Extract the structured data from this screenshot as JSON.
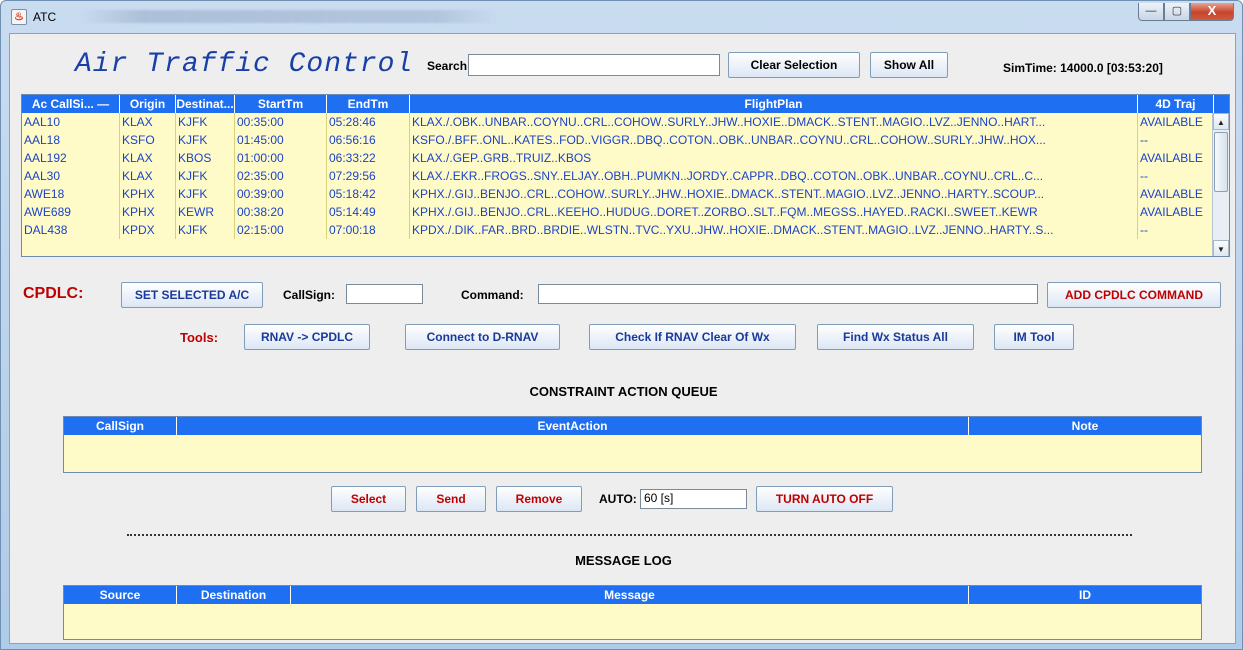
{
  "window": {
    "title": "ATC",
    "controls": {
      "minimize": "—",
      "maximize": "▢",
      "close": "X"
    }
  },
  "header": {
    "app_title": "Air Traffic Control",
    "search_label": "Search",
    "search_value": "",
    "clear_selection": "Clear Selection",
    "show_all": "Show All",
    "simtime": "SimTime: 14000.0 [03:53:20]"
  },
  "flights": {
    "columns": [
      "Ac CallSi... —",
      "Origin",
      "Destinat...",
      "StartTm",
      "EndTm",
      "FlightPlan",
      "4D Traj"
    ],
    "rows": [
      [
        "AAL10",
        "KLAX",
        "KJFK",
        "00:35:00",
        "05:28:46",
        "KLAX./.OBK..UNBAR..COYNU..CRL..COHOW..SURLY..JHW..HOXIE..DMACK..STENT..MAGIO..LVZ..JENNO..HART...",
        "AVAILABLE"
      ],
      [
        "AAL18",
        "KSFO",
        "KJFK",
        "01:45:00",
        "06:56:16",
        "KSFO./.BFF..ONL..KATES..FOD..VIGGR..DBQ..COTON..OBK..UNBAR..COYNU..CRL..COHOW..SURLY..JHW..HOX...",
        "--"
      ],
      [
        "AAL192",
        "KLAX",
        "KBOS",
        "01:00:00",
        "06:33:22",
        "KLAX./.GEP..GRB..TRUIZ..KBOS",
        "AVAILABLE"
      ],
      [
        "AAL30",
        "KLAX",
        "KJFK",
        "02:35:00",
        "07:29:56",
        "KLAX./.EKR..FROGS..SNY..ELJAY..OBH..PUMKN..JORDY..CAPPR..DBQ..COTON..OBK..UNBAR..COYNU..CRL..C...",
        "--"
      ],
      [
        "AWE18",
        "KPHX",
        "KJFK",
        "00:39:00",
        "05:18:42",
        "KPHX./.GIJ..BENJO..CRL..COHOW..SURLY..JHW..HOXIE..DMACK..STENT..MAGIO..LVZ..JENNO..HARTY..SCOUP...",
        "AVAILABLE"
      ],
      [
        "AWE689",
        "KPHX",
        "KEWR",
        "00:38:20",
        "05:14:49",
        "KPHX./.GIJ..BENJO..CRL..KEEHO..HUDUG..DORET..ZORBO..SLT..FQM..MEGSS..HAYED..RACKI..SWEET..KEWR",
        "AVAILABLE"
      ],
      [
        "DAL438",
        "KPDX",
        "KJFK",
        "02:15:00",
        "07:00:18",
        "KPDX./.DIK..FAR..BRD..BRDIE..WLSTN..TVC..YXU..JHW..HOXIE..DMACK..STENT..MAGIO..LVZ..JENNO..HARTY..S...",
        "--"
      ]
    ]
  },
  "cpdlc": {
    "label": "CPDLC:",
    "set_selected": "SET SELECTED A/C",
    "callsign_label": "CallSign:",
    "callsign_value": "",
    "command_label": "Command:",
    "command_value": "",
    "add_command": "ADD CPDLC COMMAND"
  },
  "tools": {
    "label": "Tools:",
    "buttons": [
      "RNAV -> CPDLC",
      "Connect to D-RNAV",
      "Check If RNAV Clear Of Wx",
      "Find Wx Status All",
      "IM Tool"
    ]
  },
  "constraint_queue": {
    "title": "CONSTRAINT ACTION QUEUE",
    "columns": [
      "CallSign",
      "EventAction",
      "Note"
    ],
    "select": "Select",
    "send": "Send",
    "remove": "Remove",
    "auto_label": "AUTO:",
    "auto_value": "60 [s]",
    "turn_auto_off": "TURN AUTO OFF"
  },
  "message_log": {
    "title": "MESSAGE LOG",
    "columns": [
      "Source",
      "Destination",
      "Message",
      "ID"
    ]
  },
  "colors": {
    "header_blue": "#1e6ff2",
    "row_bg": "#fffbc8",
    "text_blue": "#1b43c9",
    "accent_red": "#c00000"
  }
}
